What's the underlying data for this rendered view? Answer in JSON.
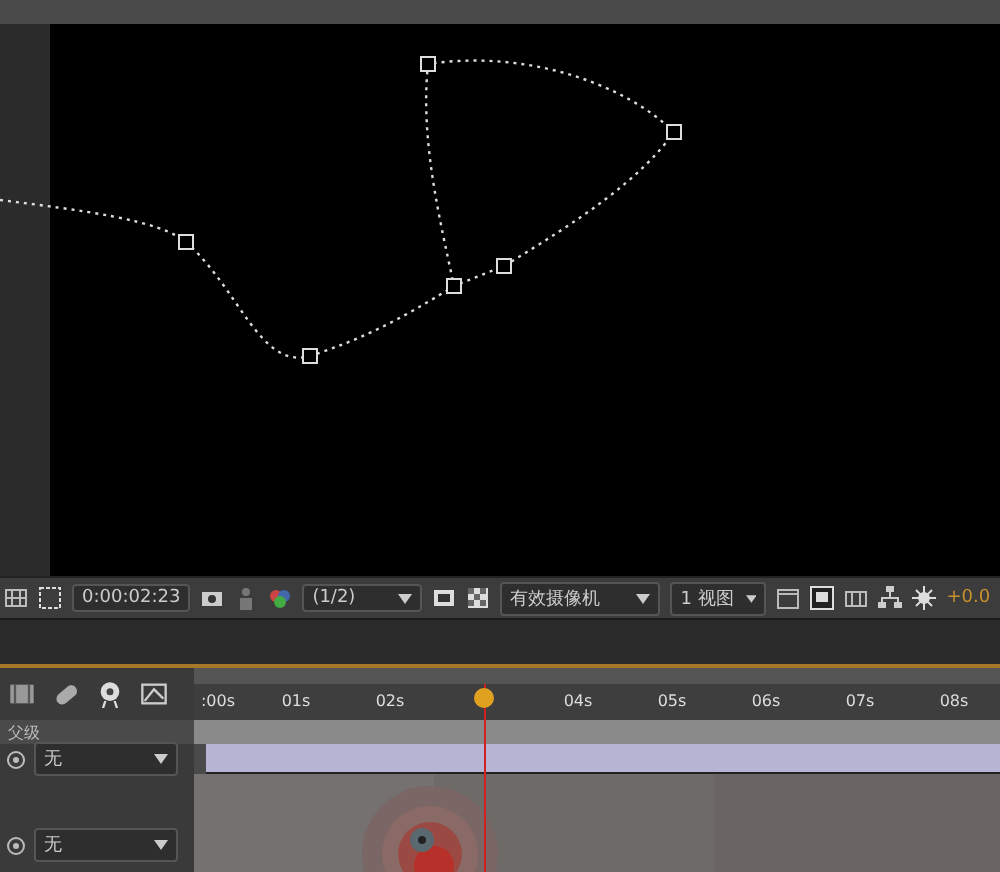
{
  "viewer": {
    "kind": "motion_path"
  },
  "viewer_toolbar": {
    "timecode": "0:00:02:23",
    "resolution": "(1/2)",
    "camera": "有效摄像机",
    "views": "1 视图",
    "exposure": "+0.0"
  },
  "timeline": {
    "ruler": [
      ":00s",
      "01s",
      "02s",
      "04s",
      "05s",
      "06s",
      "07s",
      "08s"
    ],
    "column_header": "父级",
    "layers": [
      {
        "parent": "无",
        "kind": "bar"
      },
      {
        "parent": "无",
        "kind": "picture"
      }
    ]
  }
}
